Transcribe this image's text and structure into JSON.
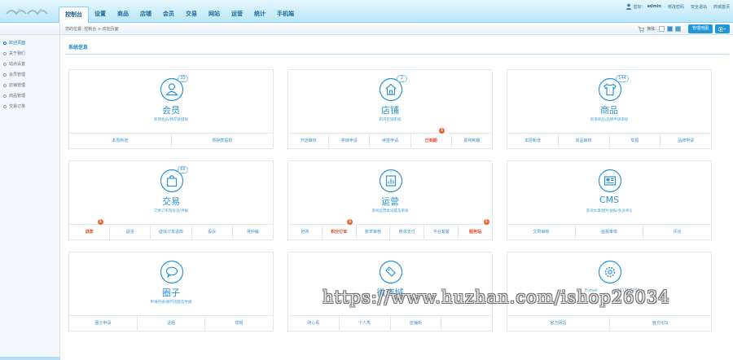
{
  "nav": {
    "items": [
      "控制台",
      "设置",
      "商品",
      "店铺",
      "会员",
      "交易",
      "网站",
      "运营",
      "统计",
      "手机端"
    ]
  },
  "top_right": {
    "greeting": "您好：",
    "username": "admin",
    "links": [
      "修改密码",
      "安全退出",
      "商城首页"
    ]
  },
  "breadcrumb": "您的位置: 控制台 > 欢迎页面",
  "subbar": {
    "skin_label": "换肤:",
    "skin_colors": [
      "#ffffff",
      "#2f8fd0",
      "#3ea8cf"
    ],
    "manager_button": "管理地图"
  },
  "sidebar": {
    "items": [
      "欢迎页面",
      "关于我们",
      "站点设置",
      "会员管理",
      "店铺管理",
      "商品管理",
      "交易订单"
    ]
  },
  "section_title": "系统信息",
  "colors": {
    "accent": "#2c93d6",
    "alert": "#e9652c",
    "hot_link": "#e14a25"
  },
  "cards": [
    {
      "title": "会员",
      "icon": "user-icon",
      "badge": "33",
      "desc": "新增会员/预存款提现",
      "links": [
        {
          "label": "本周新增"
        },
        {
          "label": "预存款提现"
        }
      ]
    },
    {
      "title": "店铺",
      "icon": "shop-icon",
      "badge": "2",
      "desc": "新开店铺审核",
      "links": [
        {
          "label": "开店审核"
        },
        {
          "label": "类目申请"
        },
        {
          "label": "续签申请"
        },
        {
          "label": "已到期",
          "hot": true,
          "alert": "1"
        },
        {
          "label": "即将到期"
        }
      ]
    },
    {
      "title": "商品",
      "icon": "tshirt-icon",
      "badge": "144",
      "desc": "新增商品/品牌申请审核",
      "links": [
        {
          "label": "本周新增"
        },
        {
          "label": "商品审核"
        },
        {
          "label": "举报"
        },
        {
          "label": "品牌申请"
        }
      ]
    },
    {
      "title": "交易",
      "icon": "bag-icon",
      "badge": "66",
      "desc": "交易订单及投诉/举报",
      "links": [
        {
          "label": "退款",
          "hot": true,
          "alert": "1"
        },
        {
          "label": "退货"
        },
        {
          "label": "虚拟订单退款"
        },
        {
          "label": "投诉"
        },
        {
          "label": "待仲裁"
        }
      ]
    },
    {
      "title": "运营",
      "icon": "chart-icon",
      "badge": "",
      "desc": "系统运营类设置及审核",
      "links": [
        {
          "label": "抢购"
        },
        {
          "label": "积分订单",
          "hot": true,
          "alert": "1"
        },
        {
          "label": "账单审核"
        },
        {
          "label": "账单支付"
        },
        {
          "label": "平台客服"
        },
        {
          "label": "服务站",
          "hot": true,
          "alert": "1"
        }
      ]
    },
    {
      "title": "CMS",
      "icon": "news-icon",
      "badge": "",
      "desc": "资讯文章/图片画报/会员评论",
      "links": [
        {
          "label": "文章审核"
        },
        {
          "label": "画报审核"
        },
        {
          "label": "评论"
        }
      ]
    },
    {
      "title": "圈子",
      "icon": "chat-icon",
      "badge": "",
      "desc": "申请开通/圈内话题及举报",
      "links": [
        {
          "label": "圈子申请"
        },
        {
          "label": "话题"
        },
        {
          "label": "举报"
        }
      ]
    },
    {
      "title": "微商城",
      "icon": "bookmark-icon",
      "badge": "",
      "desc": "",
      "links": [
        {
          "label": "随心看"
        },
        {
          "label": "个人秀"
        },
        {
          "label": "店铺街"
        },
        {
          "label": ""
        }
      ]
    },
    {
      "title": "",
      "icon": "settings-icon",
      "badge": "",
      "desc": "",
      "links": [
        {
          "label": "官方网站"
        },
        {
          "label": "官方论坛"
        }
      ]
    }
  ],
  "card_extra": {
    "email_text": "E-mail",
    "phone_text": "1041156256"
  },
  "watermark": "https://www.huzhan.com/ishop26034"
}
